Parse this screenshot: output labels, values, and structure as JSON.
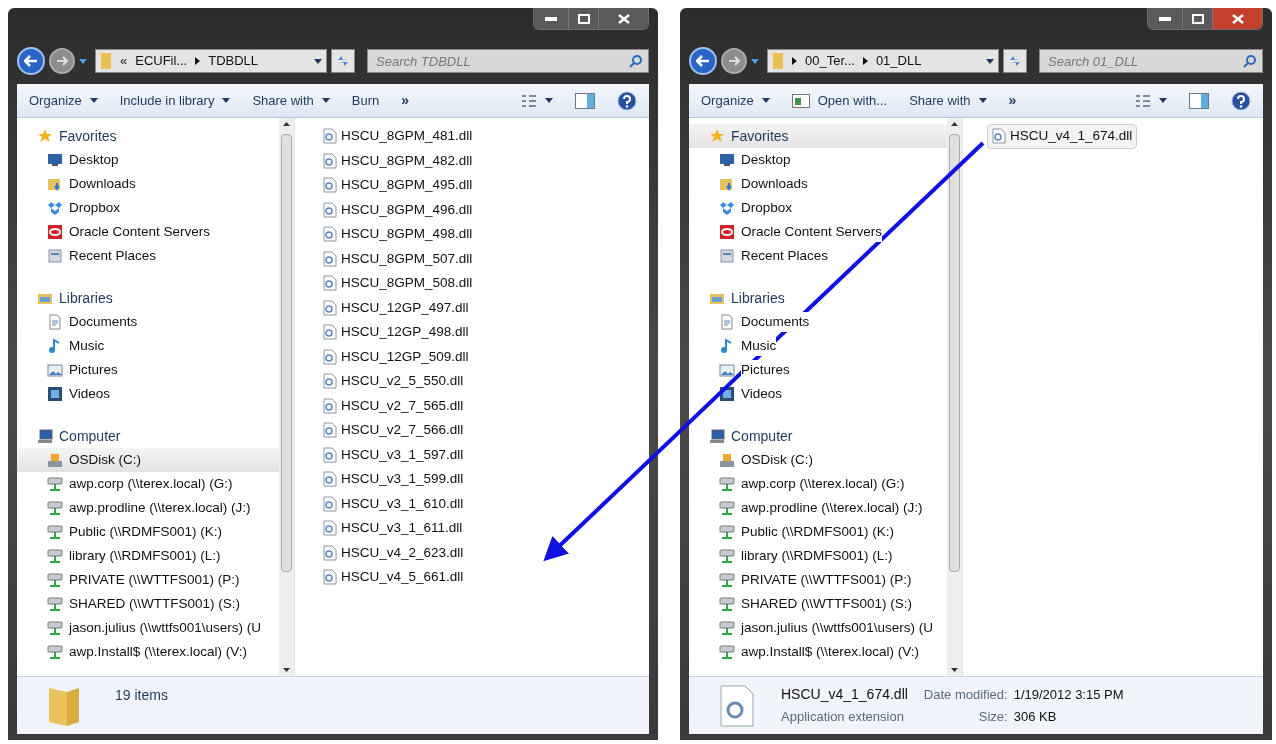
{
  "windows": [
    {
      "active": false,
      "address": {
        "overflow": "«",
        "crumbs": [
          "ECUFil...",
          "TDBDLL"
        ]
      },
      "search": {
        "placeholder": "Search TDBDLL"
      },
      "toolbar": [
        {
          "label": "Organize",
          "kind": "menu"
        },
        {
          "label": "Include in library",
          "kind": "menu"
        },
        {
          "label": "Share with",
          "kind": "menu"
        },
        {
          "label": "Burn",
          "kind": "button"
        },
        {
          "label": "»",
          "kind": "more"
        }
      ],
      "nav": [
        {
          "label": "Favorites",
          "kind": "star",
          "selected": false,
          "items": [
            {
              "label": "Desktop",
              "kind": "desktop",
              "selected": false
            },
            {
              "label": "Downloads",
              "kind": "downloads",
              "selected": false
            },
            {
              "label": "Dropbox",
              "kind": "dropbox",
              "selected": false
            },
            {
              "label": "Oracle Content Servers",
              "kind": "oracle",
              "selected": false
            },
            {
              "label": "Recent Places",
              "kind": "recent",
              "selected": false
            }
          ]
        },
        {
          "label": "Libraries",
          "kind": "library",
          "selected": false,
          "items": [
            {
              "label": "Documents",
              "kind": "documents",
              "selected": false
            },
            {
              "label": "Music",
              "kind": "music",
              "selected": false
            },
            {
              "label": "Pictures",
              "kind": "pictures",
              "selected": false
            },
            {
              "label": "Videos",
              "kind": "videos",
              "selected": false
            }
          ]
        },
        {
          "label": "Computer",
          "kind": "computer",
          "selected": false,
          "items": [
            {
              "label": "OSDisk (C:)",
              "kind": "disk",
              "selected": true
            },
            {
              "label": "awp.corp (\\\\terex.local) (G:)",
              "kind": "network",
              "selected": false
            },
            {
              "label": "awp.prodline (\\\\terex.local) (J:)",
              "kind": "network",
              "selected": false
            },
            {
              "label": "Public (\\\\RDMFS001) (K:)",
              "kind": "network",
              "selected": false
            },
            {
              "label": "library (\\\\RDMFS001) (L:)",
              "kind": "network",
              "selected": false
            },
            {
              "label": "PRIVATE (\\\\WTTFS001) (P:)",
              "kind": "network",
              "selected": false
            },
            {
              "label": "SHARED (\\\\WTTFS001) (S:)",
              "kind": "network",
              "selected": false
            },
            {
              "label": "jason.julius (\\\\wttfs001\\users) (U",
              "kind": "network",
              "selected": false
            },
            {
              "label": "awp.Install$ (\\\\terex.local) (V:)",
              "kind": "network",
              "selected": false
            }
          ]
        }
      ],
      "files": [
        {
          "name": "HSCU_8GPM_481.dll",
          "selected": false
        },
        {
          "name": "HSCU_8GPM_482.dll",
          "selected": false
        },
        {
          "name": "HSCU_8GPM_495.dll",
          "selected": false
        },
        {
          "name": "HSCU_8GPM_496.dll",
          "selected": false
        },
        {
          "name": "HSCU_8GPM_498.dll",
          "selected": false
        },
        {
          "name": "HSCU_8GPM_507.dll",
          "selected": false
        },
        {
          "name": "HSCU_8GPM_508.dll",
          "selected": false
        },
        {
          "name": "HSCU_12GP_497.dll",
          "selected": false
        },
        {
          "name": "HSCU_12GP_498.dll",
          "selected": false
        },
        {
          "name": "HSCU_12GP_509.dll",
          "selected": false
        },
        {
          "name": "HSCU_v2_5_550.dll",
          "selected": false
        },
        {
          "name": "HSCU_v2_7_565.dll",
          "selected": false
        },
        {
          "name": "HSCU_v2_7_566.dll",
          "selected": false
        },
        {
          "name": "HSCU_v3_1_597.dll",
          "selected": false
        },
        {
          "name": "HSCU_v3_1_599.dll",
          "selected": false
        },
        {
          "name": "HSCU_v3_1_610.dll",
          "selected": false
        },
        {
          "name": "HSCU_v3_1_611.dll",
          "selected": false
        },
        {
          "name": "HSCU_v4_2_623.dll",
          "selected": false
        },
        {
          "name": "HSCU_v4_5_661.dll",
          "selected": false
        }
      ],
      "status": {
        "kind": "folder",
        "count": "19 items"
      }
    },
    {
      "active": true,
      "address": {
        "crumbs": [
          "00_Ter...",
          "01_DLL"
        ]
      },
      "search": {
        "placeholder": "Search 01_DLL"
      },
      "toolbar": [
        {
          "label": "Organize",
          "kind": "menu"
        },
        {
          "label": "Open with...",
          "kind": "app"
        },
        {
          "label": "Share with",
          "kind": "menu"
        },
        {
          "label": "»",
          "kind": "more"
        }
      ],
      "nav": [
        {
          "label": "Favorites",
          "kind": "star",
          "selected": true,
          "items": [
            {
              "label": "Desktop",
              "kind": "desktop",
              "selected": false
            },
            {
              "label": "Downloads",
              "kind": "downloads",
              "selected": false
            },
            {
              "label": "Dropbox",
              "kind": "dropbox",
              "selected": false
            },
            {
              "label": "Oracle Content Servers",
              "kind": "oracle",
              "selected": false
            },
            {
              "label": "Recent Places",
              "kind": "recent",
              "selected": false
            }
          ]
        },
        {
          "label": "Libraries",
          "kind": "library",
          "selected": false,
          "items": [
            {
              "label": "Documents",
              "kind": "documents",
              "selected": false
            },
            {
              "label": "Music",
              "kind": "music",
              "selected": false
            },
            {
              "label": "Pictures",
              "kind": "pictures",
              "selected": false
            },
            {
              "label": "Videos",
              "kind": "videos",
              "selected": false
            }
          ]
        },
        {
          "label": "Computer",
          "kind": "computer",
          "selected": false,
          "items": [
            {
              "label": "OSDisk (C:)",
              "kind": "disk",
              "selected": false
            },
            {
              "label": "awp.corp (\\\\terex.local) (G:)",
              "kind": "network",
              "selected": false
            },
            {
              "label": "awp.prodline (\\\\terex.local) (J:)",
              "kind": "network",
              "selected": false
            },
            {
              "label": "Public (\\\\RDMFS001) (K:)",
              "kind": "network",
              "selected": false
            },
            {
              "label": "library (\\\\RDMFS001) (L:)",
              "kind": "network",
              "selected": false
            },
            {
              "label": "PRIVATE (\\\\WTTFS001) (P:)",
              "kind": "network",
              "selected": false
            },
            {
              "label": "SHARED (\\\\WTTFS001) (S:)",
              "kind": "network",
              "selected": false
            },
            {
              "label": "jason.julius (\\\\wttfs001\\users) (U",
              "kind": "network",
              "selected": false
            },
            {
              "label": "awp.Install$ (\\\\terex.local) (V:)",
              "kind": "network",
              "selected": false
            }
          ]
        }
      ],
      "files": [
        {
          "name": "HSCU_v4_1_674.dll",
          "selected": true
        }
      ],
      "status": {
        "kind": "file",
        "name": "HSCU_v4_1_674.dll",
        "type": "Application extension",
        "date_label": "Date modified:",
        "date": "1/19/2012 3:15 PM",
        "size_label": "Size:",
        "size": "306 KB"
      }
    }
  ]
}
